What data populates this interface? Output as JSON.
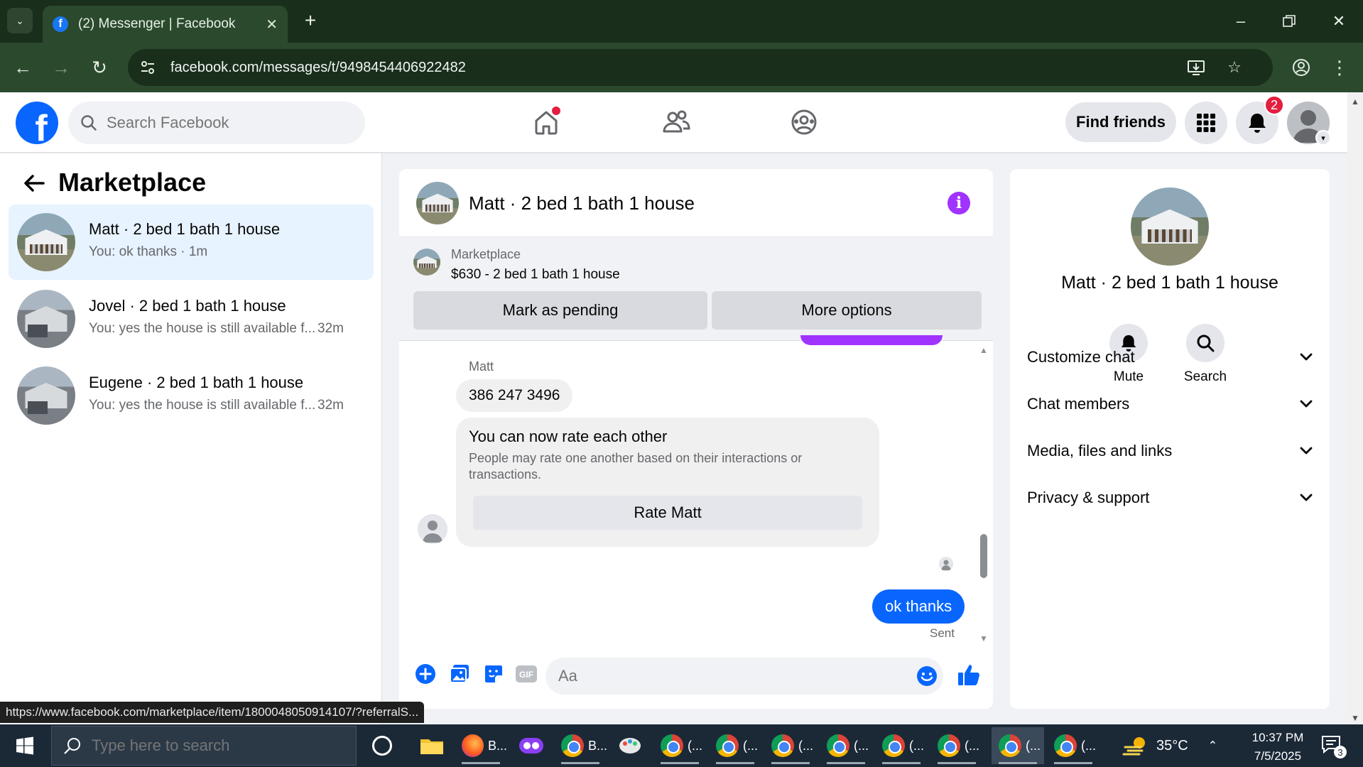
{
  "browser": {
    "tab_title": "(2) Messenger | Facebook",
    "url": "facebook.com/messages/t/9498454406922482",
    "status_url": "https://www.facebook.com/marketplace/item/1800048050914107/?referralS..."
  },
  "fb_header": {
    "search_placeholder": "Search Facebook",
    "find_friends_label": "Find friends",
    "notification_count": "2"
  },
  "left_panel": {
    "title": "Marketplace",
    "conversations": [
      {
        "name": "Matt · 2 bed 1 bath 1 house",
        "preview": "You: ok thanks · 1m",
        "time": ""
      },
      {
        "name": "Jovel · 2 bed 1 bath 1 house",
        "preview": "You: yes the house is still available f...",
        "time": "32m"
      },
      {
        "name": "Eugene · 2 bed 1 bath 1 house",
        "preview": "You: yes the house is still available f...",
        "time": "32m"
      }
    ]
  },
  "chat": {
    "title": "Matt · 2 bed 1 bath 1 house",
    "listing": {
      "label": "Marketplace",
      "title": "$630 - 2 bed 1 bath 1 house",
      "mark_pending_label": "Mark as pending",
      "more_options_label": "More options"
    },
    "messages": {
      "sender_name": "Matt",
      "received_text": "386 247 3496",
      "rating_card": {
        "title": "You can now rate each other",
        "body": "People may rate one another based on their interactions or transactions.",
        "button_label": "Rate Matt"
      },
      "sent_text": "ok thanks",
      "sent_status": "Sent"
    },
    "composer_placeholder": "Aa"
  },
  "info_panel": {
    "name": "Matt · 2 bed 1 bath 1 house",
    "actions": [
      {
        "label": "Mute",
        "icon": "bell-icon"
      },
      {
        "label": "Search",
        "icon": "search-icon"
      }
    ],
    "sections": [
      "Customize chat",
      "Chat members",
      "Media, files and links",
      "Privacy & support"
    ]
  },
  "taskbar": {
    "search_placeholder": "Type here to search",
    "apps": [
      {
        "label": "B..."
      },
      {
        "label": "B..."
      },
      {
        "label": "(..."
      },
      {
        "label": "(..."
      },
      {
        "label": "(..."
      },
      {
        "label": "(..."
      },
      {
        "label": "(..."
      },
      {
        "label": "(..."
      },
      {
        "label": "(..."
      },
      {
        "label": "(..."
      }
    ],
    "temperature": "35°C",
    "time": "10:37 PM",
    "date": "7/5/2025",
    "notification_count": "3"
  },
  "colors": {
    "fb_blue": "#0866ff",
    "messenger_purple": "#a033ff",
    "active_convo_bg": "#e7f3ff",
    "browser_frame": "#2b4a2d"
  }
}
